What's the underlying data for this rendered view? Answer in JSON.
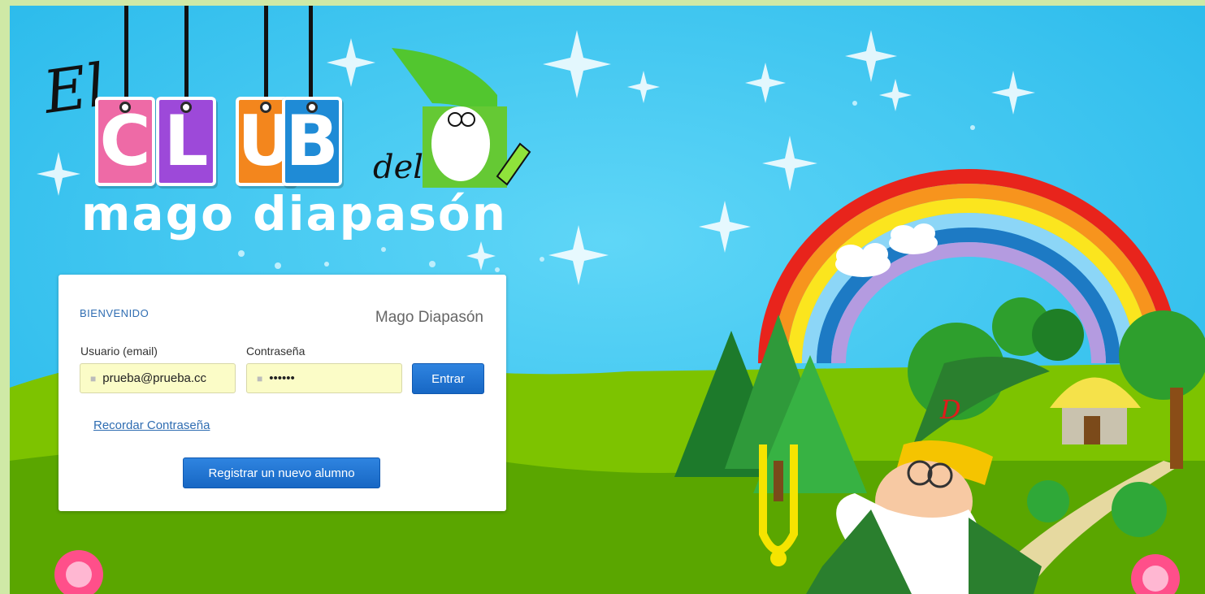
{
  "logo": {
    "el": "El",
    "letters": [
      "C",
      "L",
      "U",
      "B"
    ],
    "del": "del",
    "subtitle": "mago diapasón"
  },
  "login": {
    "welcome": "BIENVENIDO",
    "brand": "Mago Diapasón",
    "user_label": "Usuario (email)",
    "user_value": "prueba@prueba.cc",
    "password_label": "Contraseña",
    "password_value": "••••••",
    "submit_label": "Entrar",
    "forgot_label": "Recordar Contraseña",
    "register_label": "Registrar un nuevo alumno"
  },
  "icons": {
    "user": "user-icon",
    "password": "lock-icon"
  },
  "colors": {
    "sky": "#2ec3f0",
    "grass": "#7dc300",
    "tag_pink": "#ee6aa6",
    "tag_purple": "#9d49d9",
    "tag_orange": "#f3861d",
    "tag_blue": "#1f8bd6",
    "button_blue": "#1767c4",
    "link_blue": "#2f6db2"
  }
}
